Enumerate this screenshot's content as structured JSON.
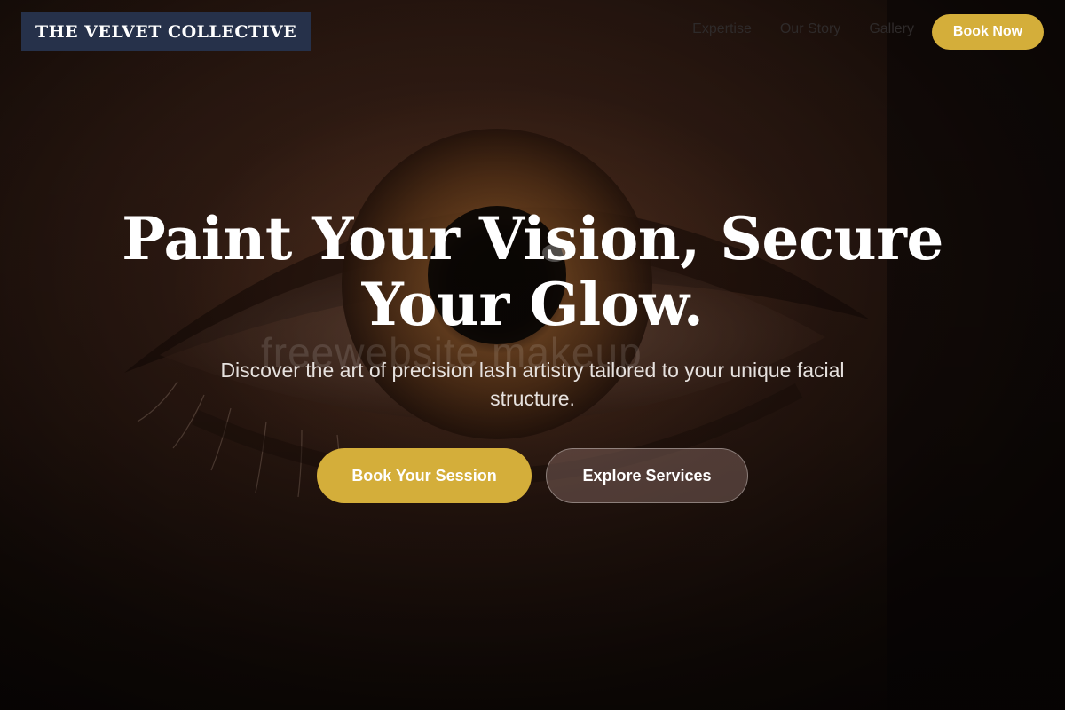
{
  "brand": {
    "name": "THE VELVET COLLECTIVE",
    "logo_bg": "#26314a"
  },
  "nav": {
    "links": [
      {
        "label": "Expertise"
      },
      {
        "label": "Our Story"
      },
      {
        "label": "Gallery"
      }
    ],
    "book_now_label": "Book Now"
  },
  "hero": {
    "headline": "Paint Your Vision, Secure Your Glow.",
    "subtext": "Discover the art of precision lash artistry tailored to your unique facial structure.",
    "watermark": "freewebsite makeup",
    "primary_cta": "Book Your Session",
    "secondary_cta": "Explore Services",
    "background_image": "close-up-eye-photo"
  },
  "colors": {
    "accent": "#d4ae3a",
    "text": "#ffffff"
  }
}
